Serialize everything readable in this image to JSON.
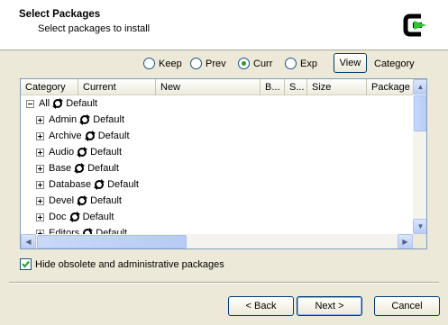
{
  "header": {
    "title": "Select Packages",
    "subtitle": "Select packages to install"
  },
  "view_options": [
    {
      "label": "Keep",
      "checked": false
    },
    {
      "label": "Prev",
      "checked": false
    },
    {
      "label": "Curr",
      "checked": true
    },
    {
      "label": "Exp",
      "checked": false
    }
  ],
  "view_button": "View",
  "view_mode": "Category",
  "columns": [
    "Category",
    "Current",
    "New",
    "B...",
    "S...",
    "Size",
    "Package"
  ],
  "tree": {
    "root": {
      "label": "All",
      "state": "Default"
    },
    "items": [
      {
        "label": "Admin",
        "state": "Default"
      },
      {
        "label": "Archive",
        "state": "Default"
      },
      {
        "label": "Audio",
        "state": "Default"
      },
      {
        "label": "Base",
        "state": "Default"
      },
      {
        "label": "Database",
        "state": "Default"
      },
      {
        "label": "Devel",
        "state": "Default"
      },
      {
        "label": "Doc",
        "state": "Default"
      },
      {
        "label": "Editors",
        "state": "Default"
      }
    ]
  },
  "hide_obsolete": {
    "label": "Hide obsolete and administrative packages",
    "checked": true
  },
  "buttons": {
    "back": "< Back",
    "next": "Next >",
    "cancel": "Cancel"
  },
  "colors": {
    "check_green": "#21a121",
    "scrollbar_blue": "#b9ccf3",
    "frame_blue": "#003c74"
  }
}
